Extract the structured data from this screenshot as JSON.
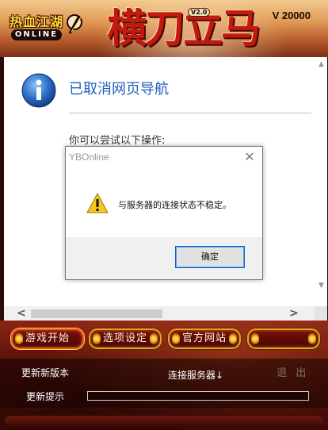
{
  "banner": {
    "logo_cn": "热血江湖",
    "logo_en": "ONLINE",
    "title_art": "横刀立马",
    "title_version_tag": "V2.0",
    "version": "V 20000"
  },
  "browser": {
    "error_title": "已取消网页导航",
    "error_subtitle": "你可以尝试以下操作:",
    "hscroll_left": "<",
    "hscroll_right": ">"
  },
  "dialog": {
    "title": "YBOnline",
    "close_glyph": "✕",
    "message": "与服务器的连接状态不稳定。",
    "ok_label": "确定"
  },
  "panel": {
    "buttons": [
      {
        "label": "游戏开始"
      },
      {
        "label": "选项设定"
      },
      {
        "label": "官方网站"
      },
      {
        "label": "退  出"
      }
    ],
    "update_version_label": "更新新版本",
    "server_status": "连接服务器↓",
    "update_hint_label": "更新提示",
    "progress": 0
  },
  "colors": {
    "link_blue": "#1f5fbf",
    "button_gold": "#e8a21a",
    "panel_red": "#5f1208"
  },
  "icons": [
    "info-icon",
    "warning-icon",
    "close-icon",
    "chevron-left-icon",
    "chevron-right-icon",
    "chevron-up-icon",
    "chevron-down-icon"
  ]
}
